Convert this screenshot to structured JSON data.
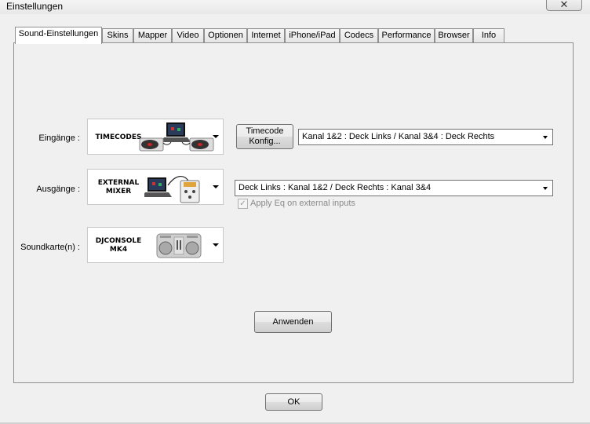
{
  "window": {
    "title": "Einstellungen",
    "close_glyph": "✕"
  },
  "tabs": [
    {
      "label": "Sound-Einstellungen",
      "active": true
    },
    {
      "label": "Skins"
    },
    {
      "label": "Mapper"
    },
    {
      "label": "Video"
    },
    {
      "label": "Optionen"
    },
    {
      "label": "Internet"
    },
    {
      "label": "iPhone/iPad"
    },
    {
      "label": "Codecs"
    },
    {
      "label": "Performance"
    },
    {
      "label": "Browser"
    },
    {
      "label": "Info"
    }
  ],
  "inputs": {
    "label": "Eingänge :",
    "device_name": "TIMECODES",
    "config_button_line1": "Timecode",
    "config_button_line2": "Konfig...",
    "routing_value": "Kanal 1&2 : Deck Links / Kanal 3&4 : Deck Rechts"
  },
  "outputs": {
    "label": "Ausgänge :",
    "device_name_line1": "EXTERNAL",
    "device_name_line2": "MIXER",
    "routing_value": "Deck Links : Kanal 1&2 / Deck Rechts : Kanal 3&4"
  },
  "soundcard": {
    "label": "Soundkarte(n) :",
    "device_name_line1": "DJCONSOLE",
    "device_name_line2": "MK4",
    "apply_eq_label": "Apply Eq on external inputs",
    "apply_eq_checked": true,
    "apply_eq_enabled": false
  },
  "apply_button": "Anwenden",
  "ok_button": "OK"
}
